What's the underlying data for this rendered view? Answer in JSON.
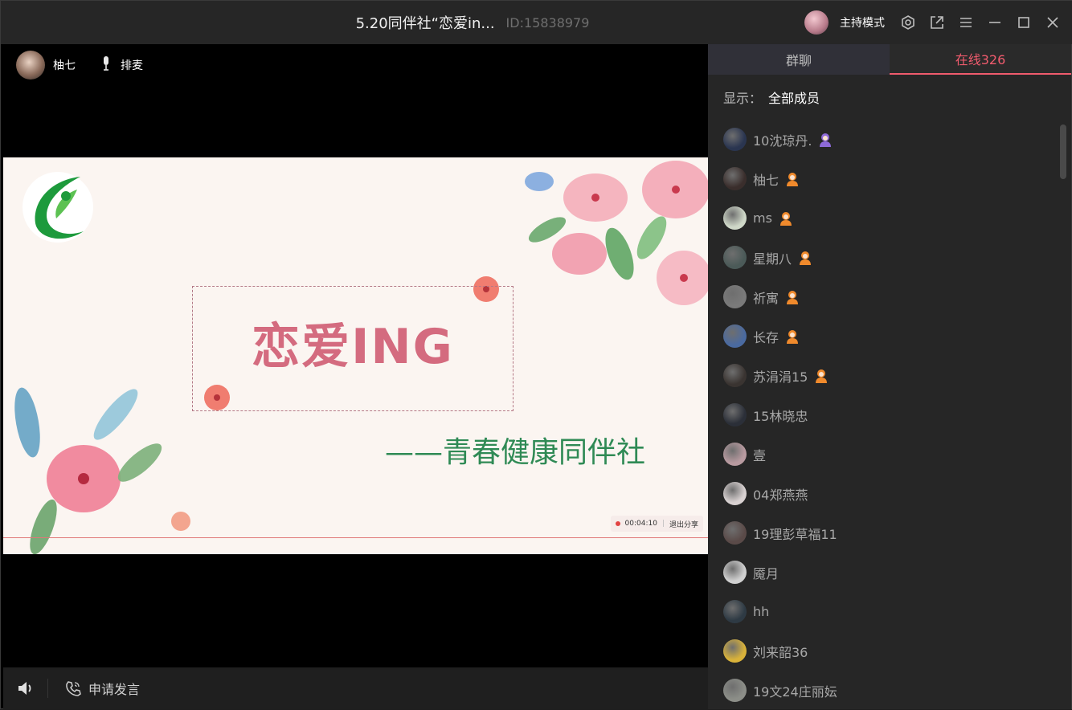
{
  "window": {
    "title": "5.20同伴社“恋爱in...",
    "room_id": "ID:15838979",
    "host_mode": "主持模式"
  },
  "stage": {
    "speaker_name": "柚七",
    "queue_label": "排麦",
    "slide": {
      "title": "恋爱ING",
      "subtitle": "——青春健康同伴社",
      "timer": "00:04:10",
      "exit_share": "退出分享"
    }
  },
  "bottom": {
    "apply_speak": "申请发言"
  },
  "panel": {
    "tabs": [
      {
        "label": "群聊",
        "active": false
      },
      {
        "label": "在线326",
        "active": true
      }
    ],
    "filter_label": "显示：",
    "filter_value": "全部成员",
    "members": [
      {
        "name": "10沈琼丹.",
        "role": "host",
        "avatar": "#2a3550"
      },
      {
        "name": "柚七",
        "role": "admin",
        "avatar": "#3a2e2c"
      },
      {
        "name": "ms",
        "role": "admin",
        "avatar": "#cfd8c8"
      },
      {
        "name": "星期八",
        "role": "admin",
        "avatar": "#4b5a58"
      },
      {
        "name": "祈寓",
        "role": "admin",
        "avatar": "#7a7a7a"
      },
      {
        "name": "长存",
        "role": "admin",
        "avatar": "#4a6aa0"
      },
      {
        "name": "苏涓涓15",
        "role": "admin",
        "avatar": "#3a3431"
      },
      {
        "name": "15林晓忠",
        "role": "none",
        "avatar": "#2b2f38"
      },
      {
        "name": "壹",
        "role": "none",
        "avatar": "#b89aa0"
      },
      {
        "name": "04郑燕燕",
        "role": "none",
        "avatar": "#d9d2d2"
      },
      {
        "name": "19理彭草福11",
        "role": "none",
        "avatar": "#5a4a48"
      },
      {
        "name": "魇月",
        "role": "none",
        "avatar": "#d0d0d0"
      },
      {
        "name": "hh",
        "role": "none",
        "avatar": "#2e3a44"
      },
      {
        "name": "刘来韶36",
        "role": "none",
        "avatar": "#d9b23a"
      },
      {
        "name": "19文24庄丽妘",
        "role": "none",
        "avatar": "#8c8e88"
      }
    ]
  },
  "colors": {
    "accent": "#ef5b6d",
    "slide_title": "#d46b7f",
    "slide_subtitle": "#2f8a55",
    "role_admin": "#f08a2c",
    "role_host": "#8e6ad8"
  }
}
